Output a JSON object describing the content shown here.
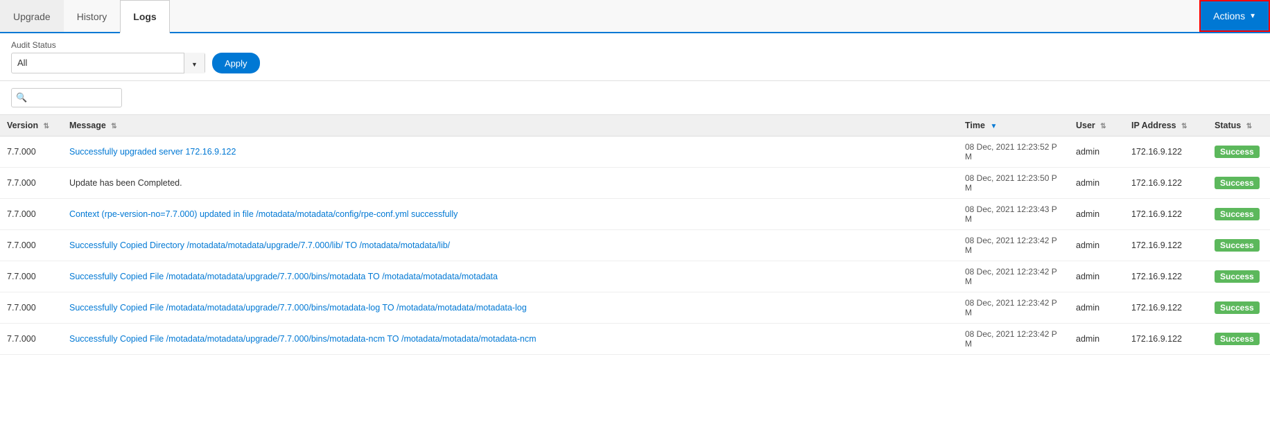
{
  "tabs": [
    {
      "id": "upgrade",
      "label": "Upgrade",
      "active": false
    },
    {
      "id": "history",
      "label": "History",
      "active": false
    },
    {
      "id": "logs",
      "label": "Logs",
      "active": true
    }
  ],
  "actions_button": {
    "label": "Actions",
    "chevron": "▼"
  },
  "filter": {
    "label": "Audit Status",
    "value": "All",
    "placeholder": "All"
  },
  "apply_button": "Apply",
  "search": {
    "placeholder": ""
  },
  "table": {
    "columns": [
      {
        "id": "version",
        "label": "Version",
        "sortable": true
      },
      {
        "id": "message",
        "label": "Message",
        "sortable": true
      },
      {
        "id": "time",
        "label": "Time",
        "sortable": true,
        "sort_active": true,
        "sort_dir": "desc"
      },
      {
        "id": "user",
        "label": "User",
        "sortable": true
      },
      {
        "id": "ip_address",
        "label": "IP Address",
        "sortable": true
      },
      {
        "id": "status",
        "label": "Status",
        "sortable": true
      }
    ],
    "rows": [
      {
        "version": "7.7.000",
        "message": "Successfully upgraded server 172.16.9.122",
        "message_link": true,
        "time": "08 Dec, 2021 12:23:52 P M",
        "user": "admin",
        "ip_address": "172.16.9.122",
        "status": "Success"
      },
      {
        "version": "7.7.000",
        "message": "Update has been Completed.",
        "message_link": false,
        "time": "08 Dec, 2021 12:23:50 P M",
        "user": "admin",
        "ip_address": "172.16.9.122",
        "status": "Success"
      },
      {
        "version": "7.7.000",
        "message": "Context (rpe-version-no=7.7.000) updated in file /motadata/motadata/config/rpe-conf.yml successfully",
        "message_link": true,
        "time": "08 Dec, 2021 12:23:43 P M",
        "user": "admin",
        "ip_address": "172.16.9.122",
        "status": "Success"
      },
      {
        "version": "7.7.000",
        "message": "Successfully Copied Directory /motadata/motadata/upgrade/7.7.000/lib/ TO /motadata/motadata/lib/",
        "message_link": true,
        "time": "08 Dec, 2021 12:23:42 P M",
        "user": "admin",
        "ip_address": "172.16.9.122",
        "status": "Success"
      },
      {
        "version": "7.7.000",
        "message": "Successfully Copied File /motadata/motadata/upgrade/7.7.000/bins/motadata TO /motadata/motadata/motadata",
        "message_link": true,
        "time": "08 Dec, 2021 12:23:42 P M",
        "user": "admin",
        "ip_address": "172.16.9.122",
        "status": "Success"
      },
      {
        "version": "7.7.000",
        "message": "Successfully Copied File /motadata/motadata/upgrade/7.7.000/bins/motadata-log TO /motadata/motadata/motadata-log",
        "message_link": true,
        "time": "08 Dec, 2021 12:23:42 P M",
        "user": "admin",
        "ip_address": "172.16.9.122",
        "status": "Success"
      },
      {
        "version": "7.7.000",
        "message": "Successfully Copied File /motadata/motadata/upgrade/7.7.000/bins/motadata-ncm TO /motadata/motadata/motadata-ncm",
        "message_link": true,
        "time": "08 Dec, 2021 12:23:42 P M",
        "user": "admin",
        "ip_address": "172.16.9.122",
        "status": "Success"
      }
    ]
  }
}
